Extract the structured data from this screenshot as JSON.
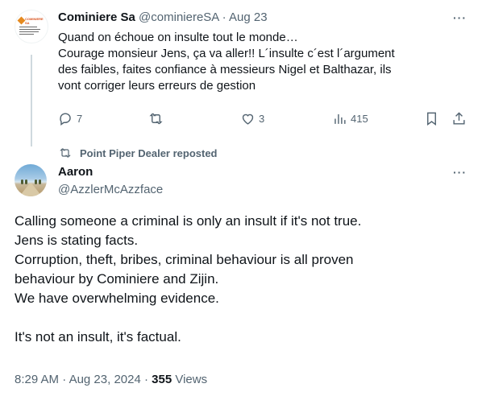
{
  "parent_tweet": {
    "author_name": "Cominiere Sa",
    "handle": "@cominiereSA",
    "separator": "·",
    "date": "Aug 23",
    "more": "···",
    "avatar_logo_text": "COMINIERE SA",
    "lines": [
      "Quand on échoue on insulte tout le monde…",
      "Courage monsieur  Jens, ça va aller!! L´insulte c´est l´argument",
      "des faibles,  faites confiance à messieurs Nigel et Balthazar, ils",
      "vont corriger leurs erreurs de gestion"
    ],
    "actions": {
      "replies": "7",
      "reposts": "",
      "likes": "3",
      "views": "415"
    }
  },
  "repost_banner": {
    "label": "Point Piper Dealer reposted"
  },
  "main_tweet": {
    "author_name": "Aaron",
    "handle": "@AzzlerMcAzzface",
    "more": "···",
    "lines": [
      "Calling someone a criminal is only an insult if it's not true.",
      "Jens is stating facts.",
      "Corruption, theft, bribes, criminal behaviour is all proven",
      "behaviour by Cominiere and Zijin.",
      "We have overwhelming evidence.",
      "",
      "It's not an insult, it's factual."
    ],
    "time": "8:29 AM",
    "date": "Aug 23, 2024",
    "separator": "·",
    "views_count": "355",
    "views_label": "Views"
  },
  "colors": {
    "text": "#0f1419",
    "muted": "#536471",
    "thread_line": "#cfd9de"
  }
}
